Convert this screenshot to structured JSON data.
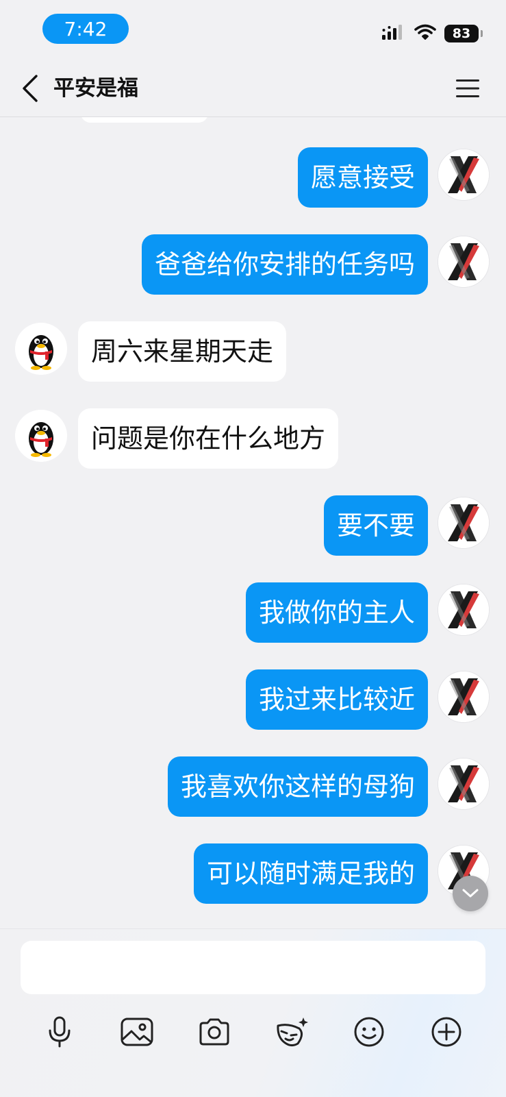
{
  "status_bar": {
    "time": "7:42",
    "battery": "83"
  },
  "header": {
    "title": "平安是福"
  },
  "messages": [
    {
      "side": "out",
      "text": "愿意接受"
    },
    {
      "side": "out",
      "text": "爸爸给你安排的任务吗"
    },
    {
      "side": "in",
      "text": "周六来星期天走"
    },
    {
      "side": "in",
      "text": "问题是你在什么地方"
    },
    {
      "side": "out",
      "text": "要不要"
    },
    {
      "side": "out",
      "text": "我做你的主人"
    },
    {
      "side": "out",
      "text": "我过来比较近"
    },
    {
      "side": "out",
      "text": "我喜欢你这样的母狗"
    },
    {
      "side": "out",
      "text": "可以随时满足我的"
    }
  ],
  "input": {
    "value": "",
    "placeholder": ""
  },
  "toolbar": {
    "icons": [
      "microphone-icon",
      "image-icon",
      "camera-icon",
      "sticker-icon",
      "emoji-icon",
      "plus-icon"
    ]
  },
  "colors": {
    "outgoing_bubble": "#0a96f5",
    "incoming_bubble": "#ffffff",
    "background": "#f1f1f3"
  }
}
